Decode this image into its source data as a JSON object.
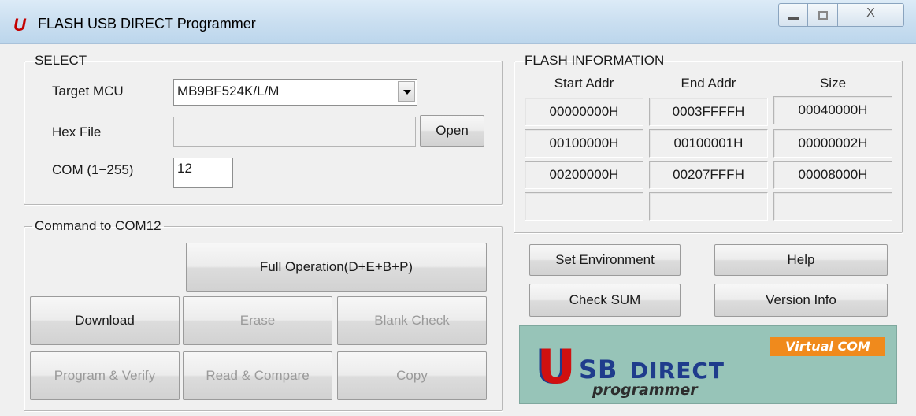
{
  "window": {
    "title": "FLASH USB DIRECT Programmer",
    "app_icon": "U",
    "minimize_icon": "minimize-icon",
    "maximize_icon": "maximize-icon",
    "close_glyph": "X"
  },
  "select": {
    "legend": "SELECT",
    "target_mcu_label": "Target MCU",
    "target_mcu_value": "MB9BF524K/L/M",
    "hex_file_label": "Hex File",
    "hex_file_value": "",
    "open_label": "Open",
    "com_label": "COM (1−255)",
    "com_value": "12"
  },
  "command": {
    "legend": "Command  to  COM12",
    "full_operation": "Full Operation(D+E+B+P)",
    "download": "Download",
    "erase": "Erase",
    "blank_check": "Blank Check",
    "program_verify": "Program & Verify",
    "read_compare": "Read & Compare",
    "copy": "Copy"
  },
  "flash": {
    "legend": "FLASH INFORMATION",
    "headers": [
      "Start Addr",
      "End Addr",
      "Size"
    ],
    "rows": [
      [
        "00000000H",
        "0003FFFFH",
        "00040000H"
      ],
      [
        "00100000H",
        "00100001H",
        "00000002H"
      ],
      [
        "00200000H",
        "00207FFFH",
        "00008000H"
      ],
      [
        "",
        "",
        ""
      ]
    ]
  },
  "actions": {
    "set_environment": "Set Environment",
    "help": "Help",
    "check_sum": "Check SUM",
    "version_info": "Version Info"
  },
  "logo": {
    "u": "U",
    "sb": "SB",
    "direct": "DIRECT",
    "programmer": "programmer",
    "virtual_com": "Virtual COM"
  },
  "colors": {
    "accent_red": "#d01010",
    "logo_blue": "#1f3c8c",
    "logo_bg": "#97c4b8",
    "badge_orange": "#f08a1c"
  }
}
